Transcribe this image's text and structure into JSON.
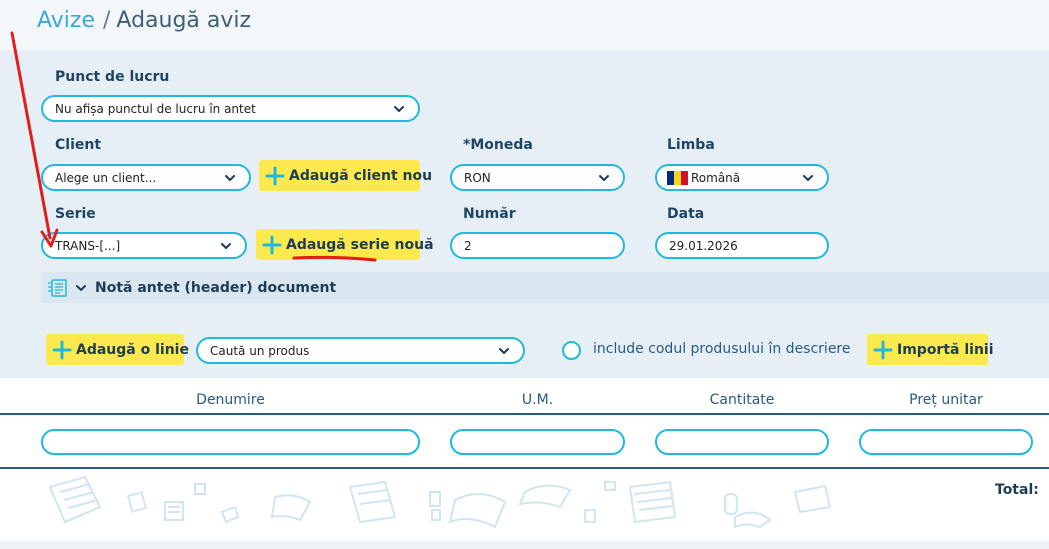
{
  "breadcrumb": {
    "parent": "Avize",
    "separator": "/",
    "current": "Adaugă aviz"
  },
  "form": {
    "punct_lucru": {
      "label": "Punct de lucru",
      "value": "Nu afișa punctul de lucru în antet"
    },
    "client": {
      "label": "Client",
      "value": "Alege un client...",
      "add_button": "Adaugă client nou"
    },
    "moneda": {
      "label": "*Moneda",
      "value": "RON"
    },
    "limba": {
      "label": "Limba",
      "value": "Română",
      "flag": [
        "#002B7F",
        "#FCD116",
        "#CE1126"
      ]
    },
    "serie": {
      "label": "Serie",
      "value": "TRANS-[...]",
      "add_button": "Adaugă serie nouă"
    },
    "numar": {
      "label": "Număr",
      "value": "2"
    },
    "data": {
      "label": "Data",
      "value": "29.01.2026"
    }
  },
  "note_header": {
    "label": "Notă antet (header) document"
  },
  "lines": {
    "add_line": "Adaugă o linie",
    "product_search": "Caută un produs",
    "include_code": "include codul produsului în descriere",
    "import_lines": "Importă linii"
  },
  "table": {
    "columns": [
      "Denumire",
      "U.M.",
      "Cantitate",
      "Preț unitar"
    ],
    "total_label": "Total:"
  },
  "colors": {
    "accent": "#20b8e0",
    "button": "#fbe94e",
    "annotation": "#e01e1e"
  }
}
